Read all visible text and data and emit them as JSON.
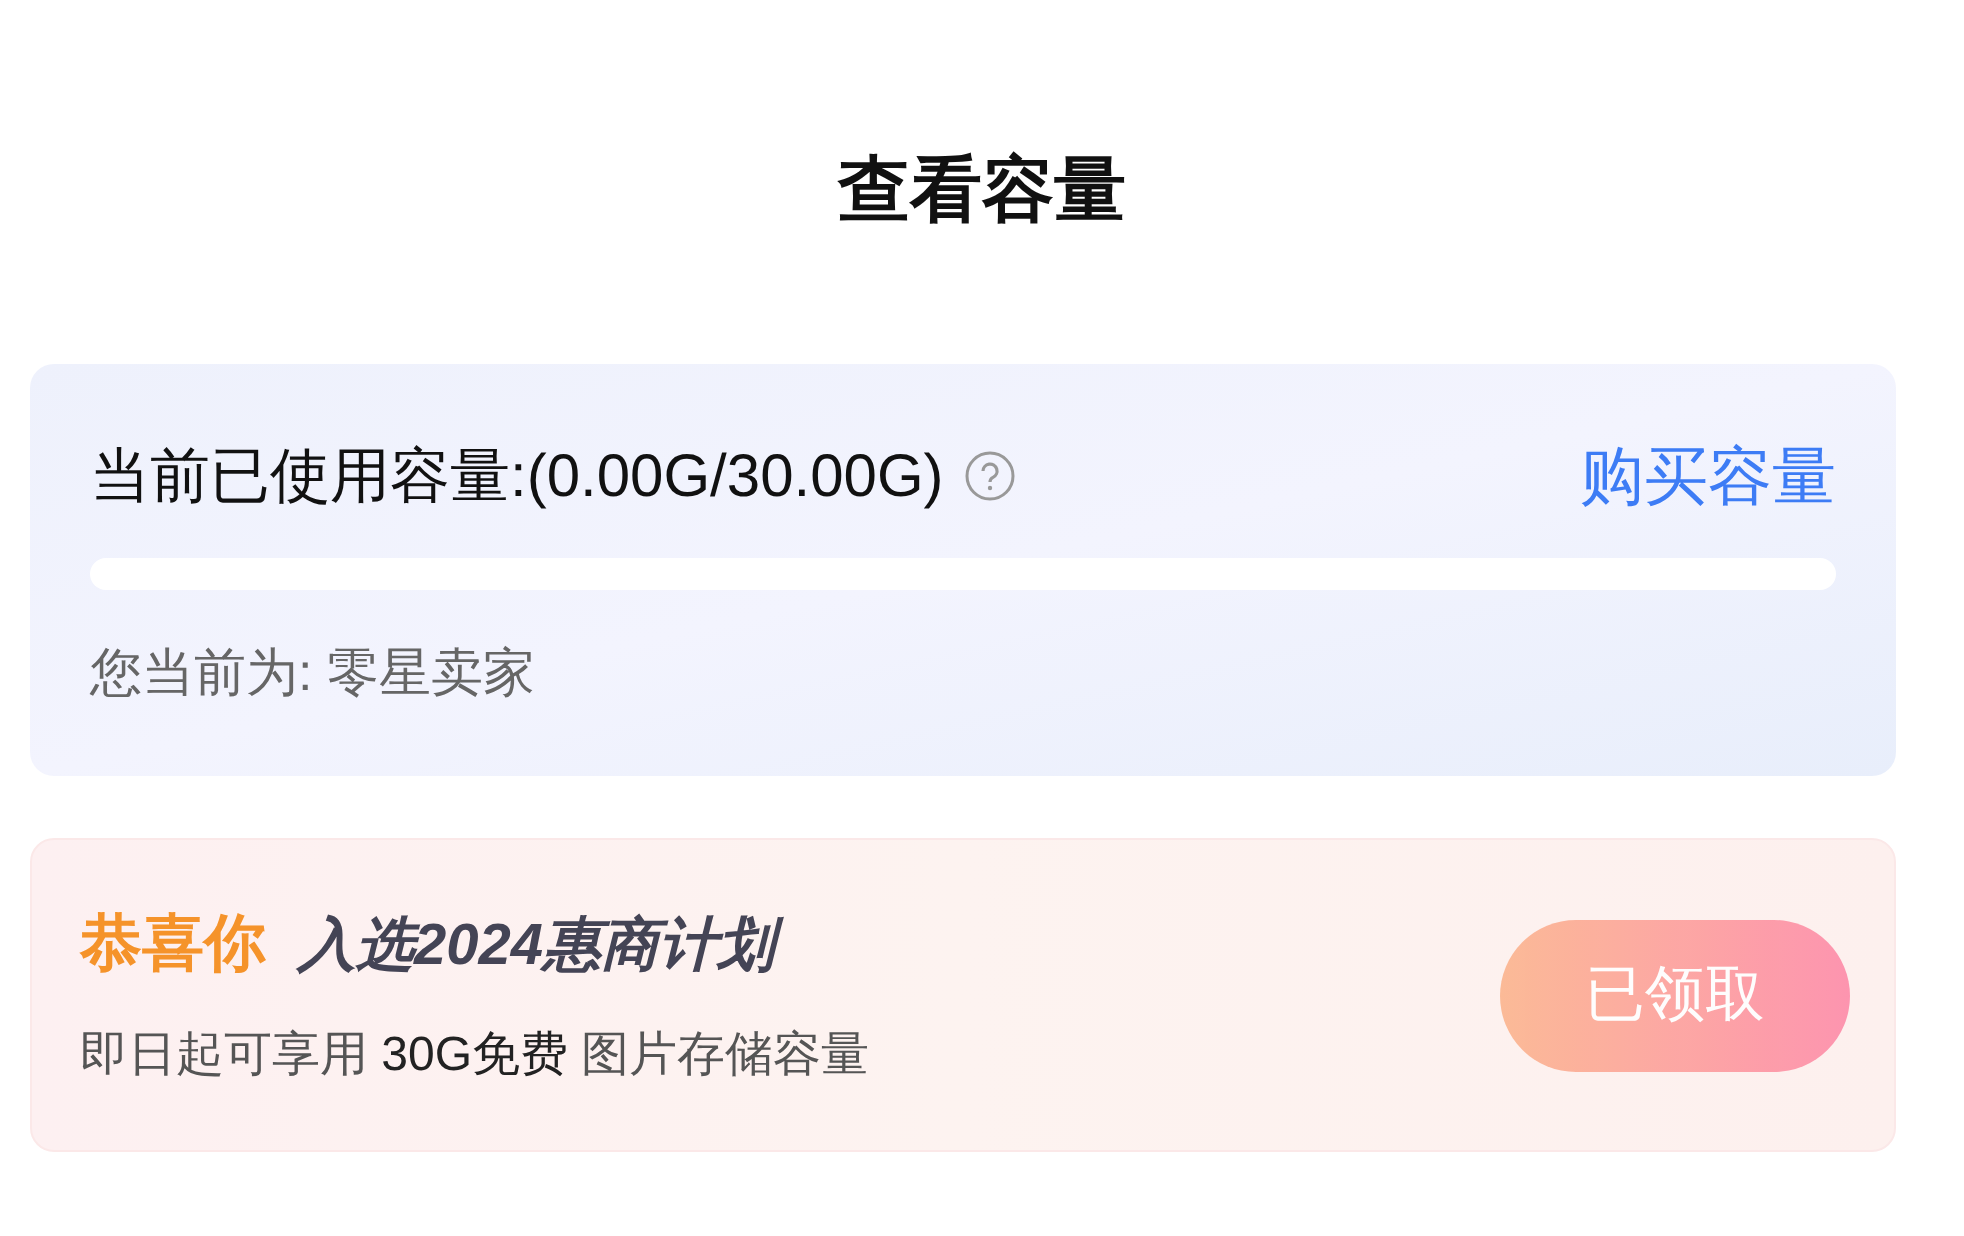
{
  "title": "查看容量",
  "usage": {
    "label": "当前已使用容量:(0.00G/30.00G)",
    "buy_link": "购买容量",
    "seller_type": "您当前为: 零星卖家"
  },
  "promo": {
    "highlight": "恭喜你",
    "headline": "入选2024惠商计划",
    "description": "即日起可享用 **30G免费** 图片存储容量",
    "button": {
      "label": "已领取",
      "disabled": true
    }
  }
}
